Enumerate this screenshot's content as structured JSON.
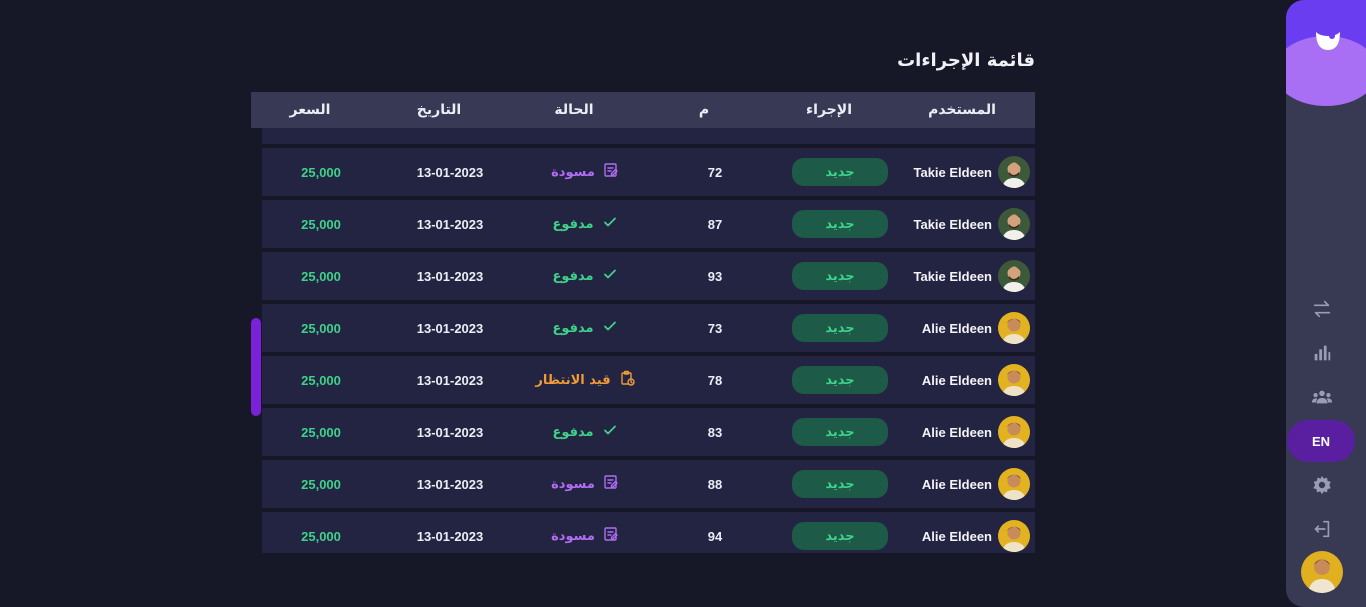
{
  "page": {
    "title": "قائمة الإجراءات"
  },
  "table": {
    "headers": {
      "user": "المستخدم",
      "action": "الإجراء",
      "num": "م",
      "status": "الحالة",
      "date": "التاريخ",
      "price": "السعر"
    },
    "rows": [
      {
        "user": "Takie Eldeen",
        "action": "جديد",
        "num": "72",
        "status": "مسودة",
        "status_type": "draft",
        "date": "13-01-2023",
        "price": "25,000"
      },
      {
        "user": "Takie Eldeen",
        "action": "جديد",
        "num": "87",
        "status": "مدفوع",
        "status_type": "paid",
        "date": "13-01-2023",
        "price": "25,000"
      },
      {
        "user": "Takie Eldeen",
        "action": "جديد",
        "num": "93",
        "status": "مدفوع",
        "status_type": "paid",
        "date": "13-01-2023",
        "price": "25,000"
      },
      {
        "user": "Alie Eldeen",
        "action": "جديد",
        "num": "73",
        "status": "مدفوع",
        "status_type": "paid",
        "date": "13-01-2023",
        "price": "25,000"
      },
      {
        "user": "Alie Eldeen",
        "action": "جديد",
        "num": "78",
        "status": "قيد الانتظار",
        "status_type": "pending",
        "date": "13-01-2023",
        "price": "25,000"
      },
      {
        "user": "Alie Eldeen",
        "action": "جديد",
        "num": "83",
        "status": "مدفوع",
        "status_type": "paid",
        "date": "13-01-2023",
        "price": "25,000"
      },
      {
        "user": "Alie Eldeen",
        "action": "جديد",
        "num": "88",
        "status": "مسودة",
        "status_type": "draft",
        "date": "13-01-2023",
        "price": "25,000"
      },
      {
        "user": "Alie Eldeen",
        "action": "جديد",
        "num": "94",
        "status": "مسودة",
        "status_type": "draft",
        "date": "13-01-2023",
        "price": "25,000"
      }
    ]
  },
  "sidebar": {
    "items": [
      {
        "icon": "transfer-icon"
      },
      {
        "icon": "chart-icon"
      },
      {
        "icon": "users-icon"
      },
      {
        "icon": "gear-icon"
      },
      {
        "icon": "logout-icon"
      }
    ],
    "lang_label": "EN"
  },
  "colors": {
    "background": "#171827",
    "sidebar": "#383a53",
    "brand": "#6b3df0",
    "accent": "#7b22d8",
    "paid": "#3ed28b",
    "draft": "#b06cf3",
    "pending": "#f09a39"
  }
}
